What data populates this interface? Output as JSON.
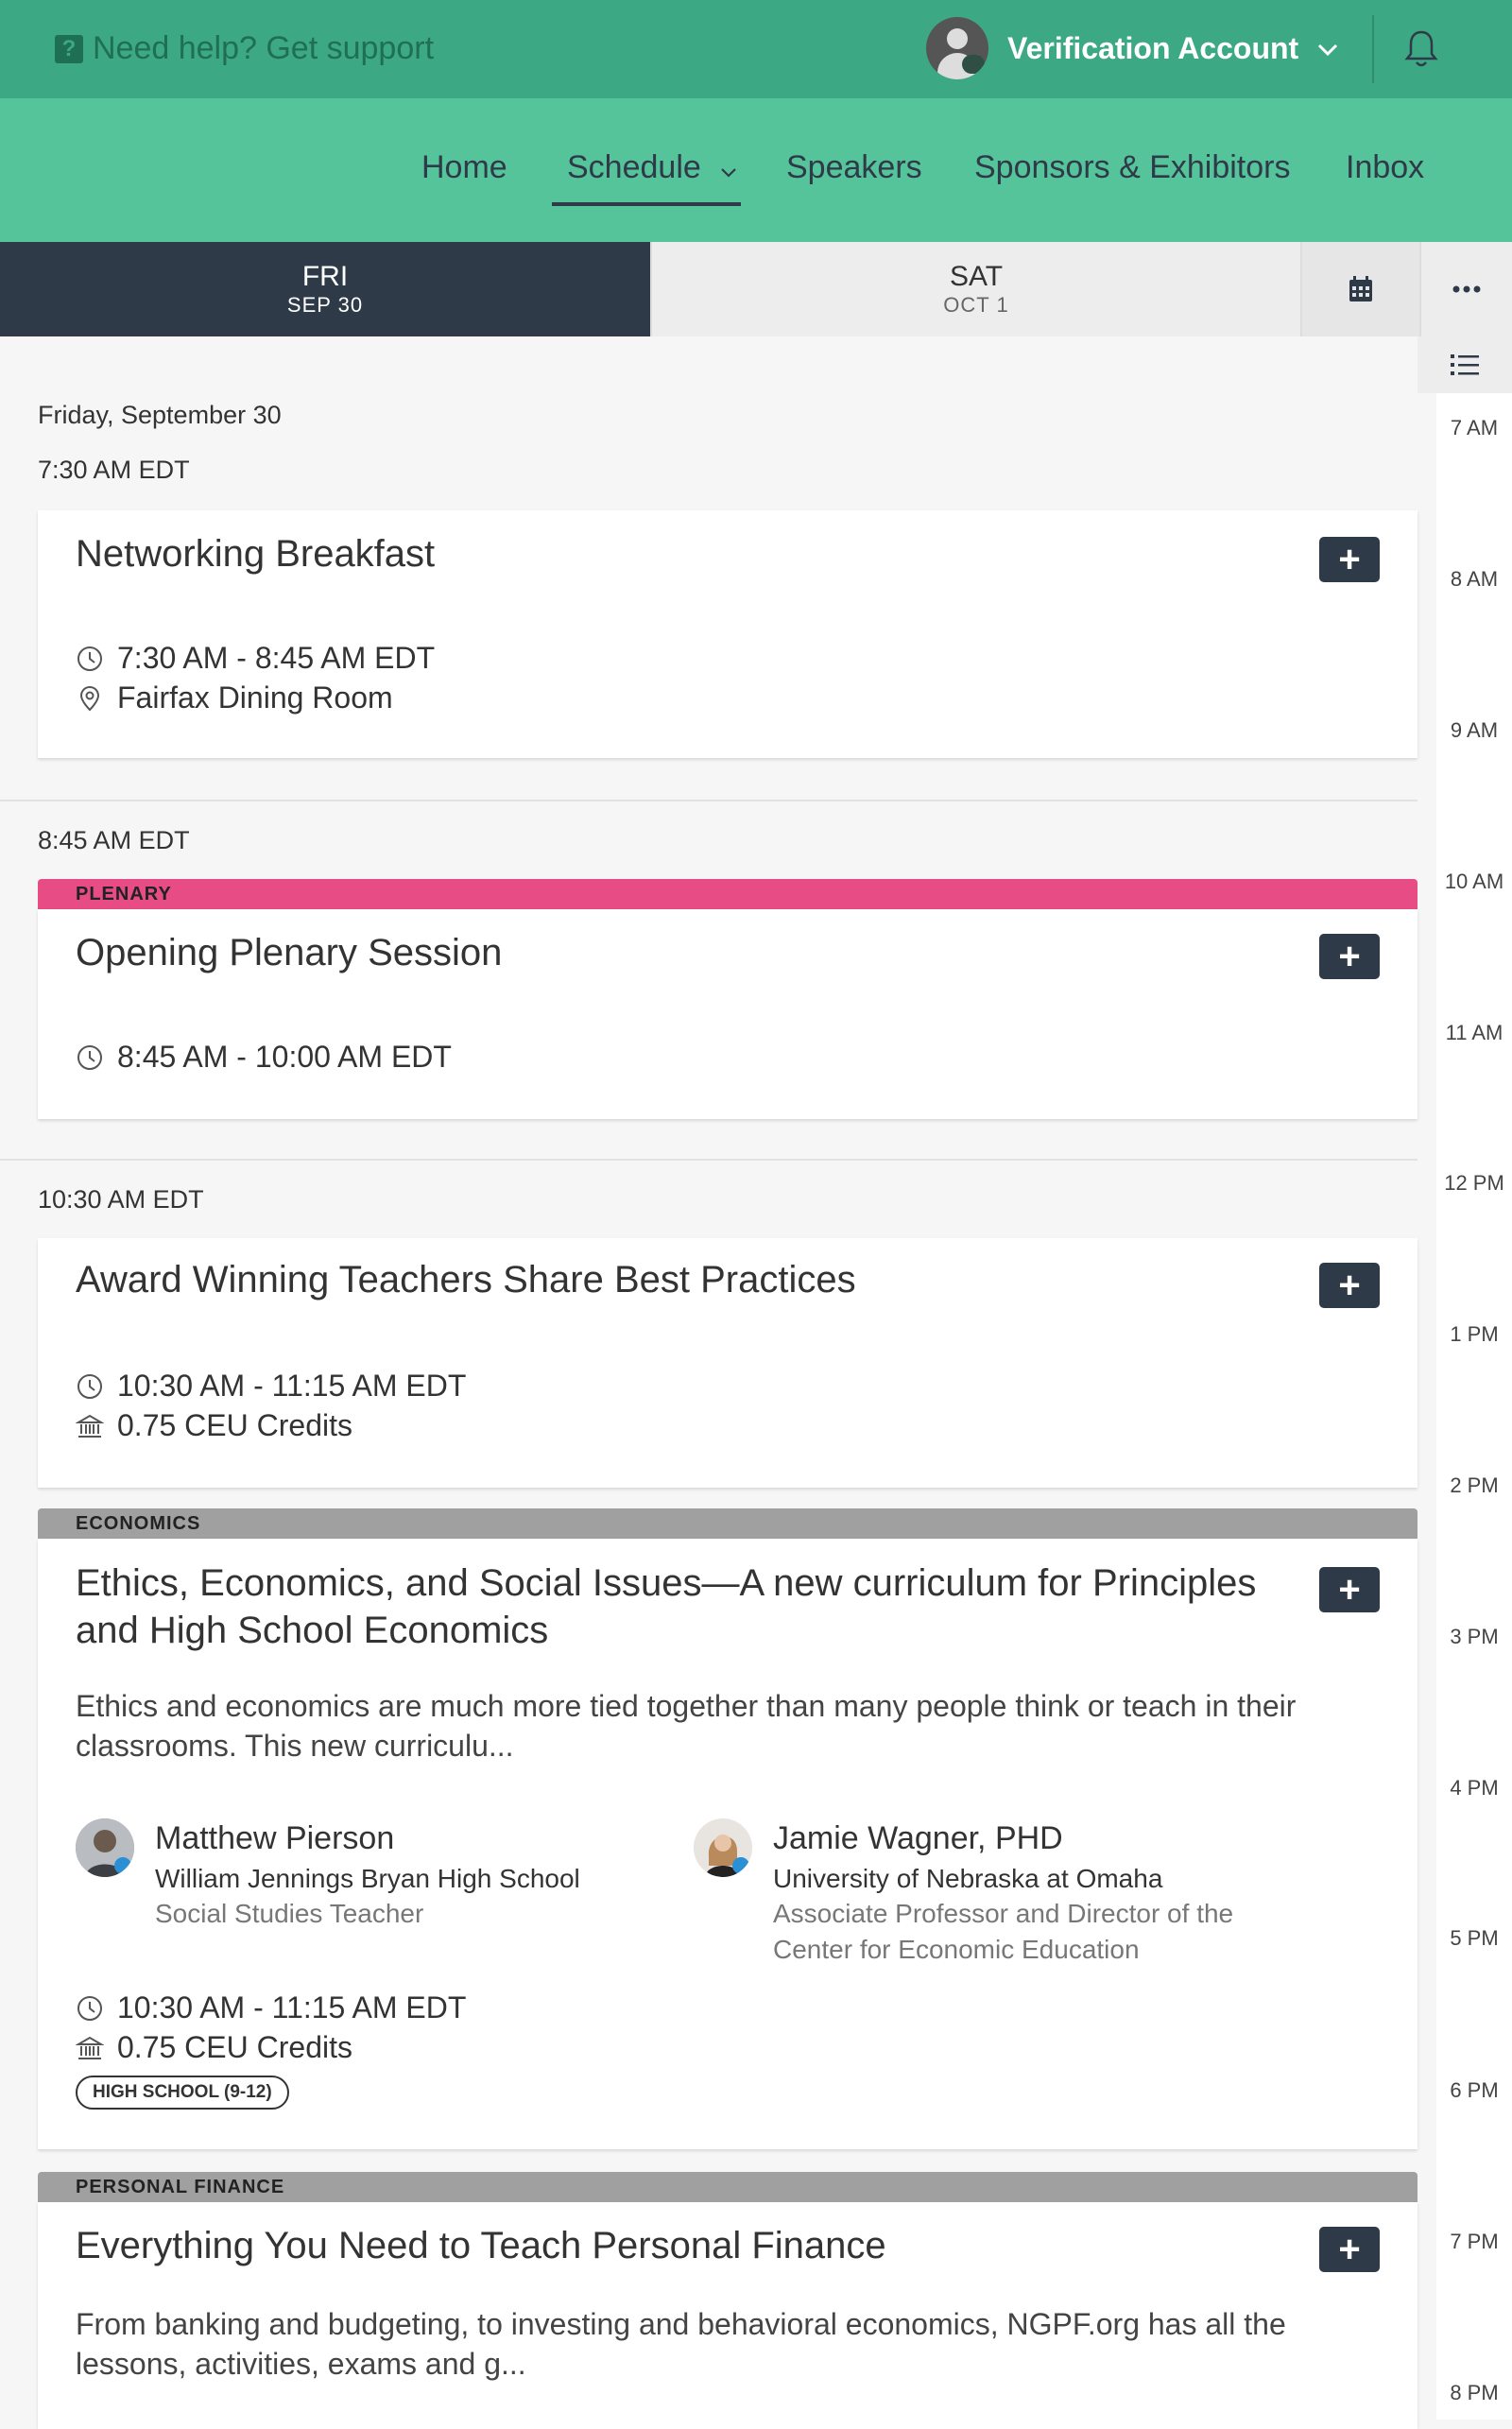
{
  "topbar": {
    "help_text": "Need help? Get support",
    "account_name": "Verification Account"
  },
  "nav": {
    "items": [
      "Home",
      "Schedule",
      "Speakers",
      "Sponsors & Exhibitors",
      "Inbox"
    ],
    "active": "Schedule"
  },
  "day_tabs": [
    {
      "dow": "FRI",
      "date": "SEP 30",
      "active": true
    },
    {
      "dow": "SAT",
      "date": "OCT 1",
      "active": false
    }
  ],
  "timeline": [
    "7 AM",
    "8 AM",
    "9 AM",
    "10 AM",
    "11 AM",
    "12 PM",
    "1 PM",
    "2 PM",
    "3 PM",
    "4 PM",
    "5 PM",
    "6 PM",
    "7 PM",
    "8 PM"
  ],
  "day_heading": "Friday, September 30",
  "time_groups": [
    "7:30 AM EDT",
    "8:45 AM EDT",
    "10:30 AM EDT"
  ],
  "sessions": [
    {
      "title": "Networking Breakfast",
      "time": "7:30 AM - 8:45 AM EDT",
      "location": "Fairfax Dining Room"
    },
    {
      "track": "PLENARY",
      "track_color": "#e84c84",
      "title": "Opening Plenary Session",
      "time": "8:45 AM - 10:00 AM EDT"
    },
    {
      "title": "Award Winning Teachers Share Best Practices",
      "time": "10:30 AM - 11:15 AM EDT",
      "credits": "0.75 CEU Credits"
    },
    {
      "track": "ECONOMICS",
      "track_color": "#a0a0a0",
      "title_line1": "Ethics, Economics, and Social Issues—A new curriculum for Principles",
      "title_line2": "and High School Economics",
      "desc_line1": "Ethics and economics are much more tied together than many people think or teach in their",
      "desc_line2": "classrooms. This new curriculu...",
      "speakers": [
        {
          "name": "Matthew Pierson",
          "org": "William Jennings Bryan High School",
          "title_line1": "Social Studies Teacher"
        },
        {
          "name": "Jamie Wagner, PHD",
          "org": "University of Nebraska at Omaha",
          "title_line1": "Associate Professor and Director of the",
          "title_line2": "Center for Economic Education"
        }
      ],
      "time": "10:30 AM - 11:15 AM EDT",
      "credits": "0.75 CEU Credits",
      "tag": "HIGH SCHOOL (9-12)"
    },
    {
      "track": "PERSONAL FINANCE",
      "track_color": "#a0a0a0",
      "title": "Everything You Need to Teach Personal Finance",
      "desc_line1": "From banking and budgeting, to investing and behavioral economics, NGPF.org has all the",
      "desc_line2": "lessons, activities, exams and g..."
    }
  ]
}
